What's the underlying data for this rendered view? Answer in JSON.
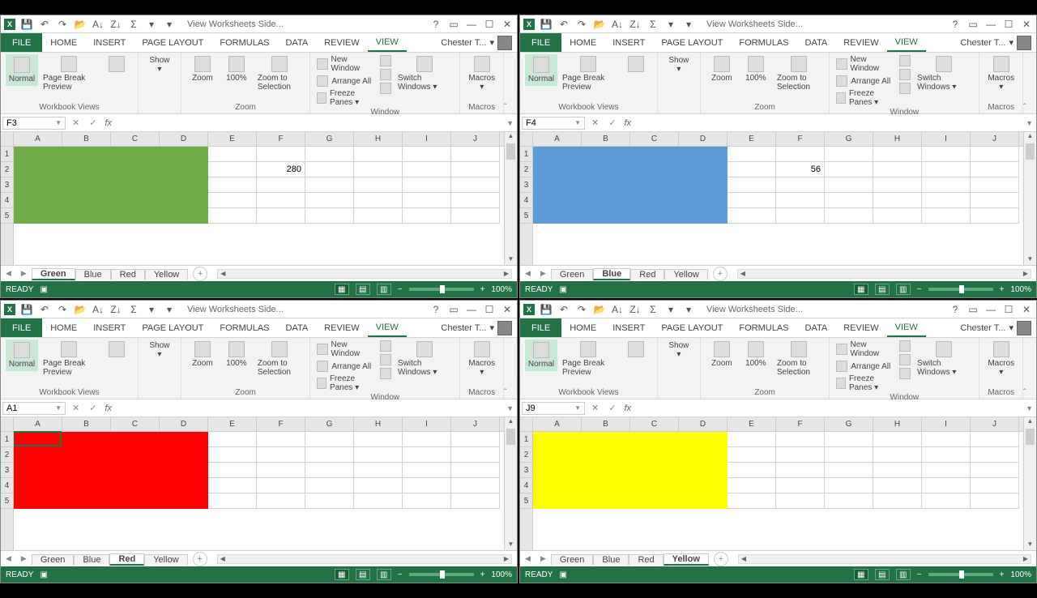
{
  "app_title": "View Worksheets Side...",
  "ribbon_tabs": [
    "HOME",
    "INSERT",
    "PAGE LAYOUT",
    "FORMULAS",
    "DATA",
    "REVIEW",
    "VIEW"
  ],
  "file_label": "FILE",
  "active_tab": "VIEW",
  "user": "Chester T...",
  "ribbon": {
    "views_group": "Workbook Views",
    "normal": "Normal",
    "pagebreak": "Page Break Preview",
    "show": "Show",
    "zoom_group": "Zoom",
    "zoom": "Zoom",
    "pct100": "100%",
    "zoom_sel": "Zoom to Selection",
    "window_group": "Window",
    "new_window": "New Window",
    "arrange_all": "Arrange All",
    "freeze": "Freeze Panes",
    "switch": "Switch Windows",
    "macros_group": "Macros",
    "macros": "Macros"
  },
  "sheets": [
    "Green",
    "Blue",
    "Red",
    "Yellow"
  ],
  "columns": [
    "A",
    "B",
    "C",
    "D",
    "E",
    "F",
    "G",
    "H",
    "I",
    "J"
  ],
  "rows": [
    1,
    2,
    3,
    4,
    5
  ],
  "status_ready": "READY",
  "zoom_pct": "100%",
  "windows": [
    {
      "id": "tl",
      "namebox": "F3",
      "formula": "",
      "active_sheet": "Green",
      "fill_color": "#70AD47",
      "cell_value": {
        "col": "F",
        "row": 2,
        "text": "280"
      },
      "selected_cell": null
    },
    {
      "id": "tr",
      "namebox": "F4",
      "formula": "",
      "active_sheet": "Blue",
      "fill_color": "#5B9BD5",
      "cell_value": {
        "col": "F",
        "row": 2,
        "text": "56"
      },
      "selected_cell": null
    },
    {
      "id": "bl",
      "namebox": "A1",
      "formula": "",
      "active_sheet": "Red",
      "fill_color": "#FF0000",
      "cell_value": null,
      "selected_cell": {
        "col": "A",
        "row": 1
      }
    },
    {
      "id": "br",
      "namebox": "J9",
      "formula": "",
      "active_sheet": "Yellow",
      "fill_color": "#FFFF00",
      "cell_value": null,
      "selected_cell": null
    }
  ]
}
